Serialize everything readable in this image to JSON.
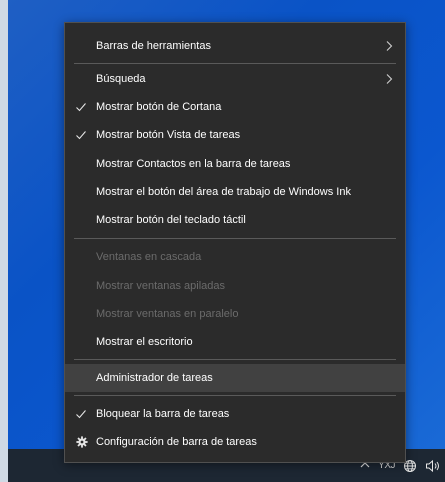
{
  "menu": {
    "items": [
      {
        "label": "Barras de herramientas",
        "submenu": true,
        "icon": "chevron-right-icon"
      },
      {
        "label": "Búsqueda",
        "submenu": true,
        "icon": "chevron-right-icon"
      },
      {
        "label": "Mostrar botón de Cortana",
        "checked": true
      },
      {
        "label": "Mostrar botón Vista de tareas",
        "checked": true
      },
      {
        "label": "Mostrar Contactos en la barra de tareas"
      },
      {
        "label": "Mostrar el botón del área de trabajo de Windows Ink"
      },
      {
        "label": "Mostrar botón del teclado táctil"
      },
      {
        "label": "Ventanas en cascada",
        "disabled": true
      },
      {
        "label": "Mostrar ventanas apiladas",
        "disabled": true
      },
      {
        "label": "Mostrar ventanas en paralelo",
        "disabled": true
      },
      {
        "label": "Mostrar el escritorio"
      },
      {
        "label": "Administrador de tareas",
        "highlighted": true
      },
      {
        "label": "Bloquear la barra de tareas",
        "checked": true
      },
      {
        "label": "Configuración de barra de tareas",
        "icon": "gear-icon"
      }
    ]
  },
  "taskbar": {
    "tray": {
      "chevron_icon": "chevron-up-icon",
      "ime_label": "YXJ",
      "network_icon": "globe-network-icon",
      "volume_icon": "volume-icon"
    }
  },
  "colors": {
    "menu_bg": "#2b2b2b",
    "menu_highlight": "#414141",
    "menu_text": "#ffffff",
    "menu_disabled": "#6b6b6b",
    "desktop_blue": "#0a53c6",
    "taskbar": "#1d2733"
  }
}
